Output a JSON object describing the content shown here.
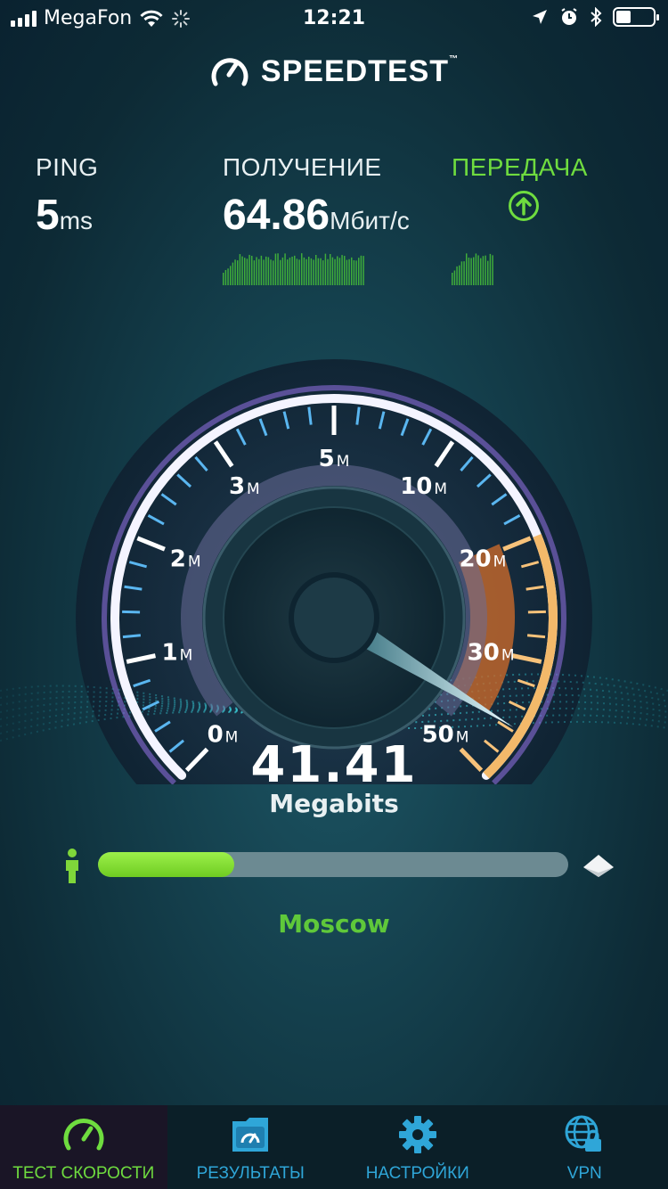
{
  "status_bar": {
    "carrier": "MegaFon",
    "time": "12:21",
    "battery_level": 0.4,
    "icons": [
      "signal-icon",
      "wifi-icon",
      "activity-spinner-icon",
      "location-arrow-icon",
      "alarm-icon",
      "bluetooth-icon",
      "battery-icon"
    ]
  },
  "app": {
    "logo_text": "SPEEDTEST",
    "logo_tm": "™",
    "logo_icon": "speedometer-icon"
  },
  "metrics": {
    "ping": {
      "label": "PING",
      "value": "5",
      "unit": "ms"
    },
    "download": {
      "label": "ПОЛУЧЕНИЕ",
      "value": "64.86",
      "unit": "Мбит/с"
    },
    "upload": {
      "label": "ПЕРЕДАЧА",
      "icon": "upload-arrow-icon"
    },
    "colors": {
      "upload_active": "#6fdc3f",
      "label": "#e8f0f2"
    }
  },
  "gauge": {
    "ticks": [
      {
        "label": "0",
        "unit": "M"
      },
      {
        "label": "1",
        "unit": "M"
      },
      {
        "label": "2",
        "unit": "M"
      },
      {
        "label": "3",
        "unit": "M"
      },
      {
        "label": "5",
        "unit": "M"
      },
      {
        "label": "10",
        "unit": "M"
      },
      {
        "label": "20",
        "unit": "M"
      },
      {
        "label": "30",
        "unit": "M"
      },
      {
        "label": "50",
        "unit": "M"
      }
    ],
    "current_value": "41.41",
    "current_unit": "Megabits",
    "needle_value": 41.41
  },
  "progress": {
    "fraction": 0.29,
    "server": "Moscow",
    "left_icon": "person-icon",
    "right_icon": "server-icon"
  },
  "tabs": [
    {
      "label": "ТЕСТ СКОРОСТИ",
      "icon": "speedometer-icon",
      "active": true
    },
    {
      "label": "РЕЗУЛЬТАТЫ",
      "icon": "results-folder-icon",
      "active": false
    },
    {
      "label": "НАСТРОЙКИ",
      "icon": "gear-icon",
      "active": false
    },
    {
      "label": "VPN",
      "icon": "vpn-globe-lock-icon",
      "active": false
    }
  ]
}
